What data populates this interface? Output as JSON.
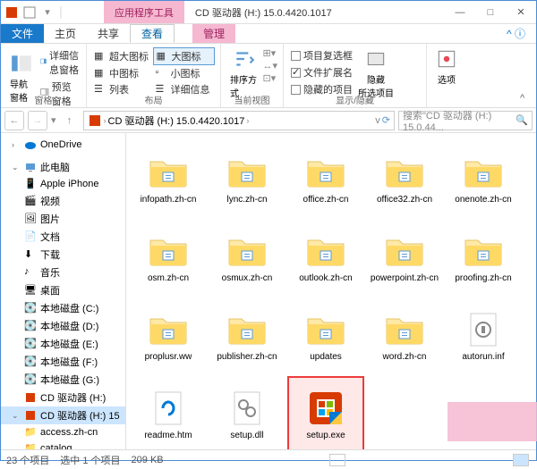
{
  "titlebar": {
    "tool_tab": "应用程序工具",
    "title": "CD 驱动器 (H:) 15.0.4420.1017"
  },
  "win_controls": {
    "min": "—",
    "max": "□",
    "close": "✕"
  },
  "tabs": {
    "file": "文件",
    "home": "主页",
    "share": "共享",
    "view": "查看",
    "manage": "管理"
  },
  "ribbon": {
    "panes": {
      "nav": "导航窗格",
      "detail_pane": "详细信息窗格",
      "preview_pane": "预览窗格",
      "group_label": "窗格"
    },
    "layout": {
      "extra_large": "超大图标",
      "large": "大图标",
      "medium": "中图标",
      "small": "小图标",
      "list": "列表",
      "details": "详细信息",
      "group_label": "布局"
    },
    "view": {
      "sort": "排序方式",
      "group_label": "当前视图"
    },
    "showhide": {
      "item_checkboxes": "项目复选框",
      "file_ext": "文件扩展名",
      "hidden_items": "隐藏的项目",
      "hide_selected_big": "隐藏",
      "hide_selected_sub": "所选项目",
      "group_label": "显示/隐藏"
    },
    "options": "选项"
  },
  "addr": {
    "root": "",
    "seg1": "CD 驱动器 (H:) 15.0.4420.1017",
    "search_placeholder": "搜索\"CD 驱动器 (H:) 15.0.44..."
  },
  "sidebar": {
    "onedrive": "OneDrive",
    "thispc": "此电脑",
    "iphone": "Apple iPhone",
    "videos": "视频",
    "pictures": "图片",
    "documents": "文档",
    "downloads": "下载",
    "music": "音乐",
    "desktop": "桌面",
    "disk_c": "本地磁盘 (C:)",
    "disk_d": "本地磁盘 (D:)",
    "disk_e": "本地磁盘 (E:)",
    "disk_f": "本地磁盘 (F:)",
    "disk_g": "本地磁盘 (G:)",
    "cd_h": "CD 驱动器 (H:)",
    "cd_h_sel": "CD 驱动器 (H:) 15",
    "access": "access.zh-cn",
    "catalog": "catalog"
  },
  "items": [
    {
      "name": "infopath.zh-cn",
      "type": "folder"
    },
    {
      "name": "lync.zh-cn",
      "type": "folder"
    },
    {
      "name": "office.zh-cn",
      "type": "folder"
    },
    {
      "name": "office32.zh-cn",
      "type": "folder"
    },
    {
      "name": "onenote.zh-cn",
      "type": "folder"
    },
    {
      "name": "osm.zh-cn",
      "type": "folder"
    },
    {
      "name": "osmux.zh-cn",
      "type": "folder"
    },
    {
      "name": "outlook.zh-cn",
      "type": "folder"
    },
    {
      "name": "powerpoint.zh-cn",
      "type": "folder"
    },
    {
      "name": "proofing.zh-cn",
      "type": "folder"
    },
    {
      "name": "proplusr.ww",
      "type": "folder"
    },
    {
      "name": "publisher.zh-cn",
      "type": "folder"
    },
    {
      "name": "updates",
      "type": "folder"
    },
    {
      "name": "word.zh-cn",
      "type": "folder"
    },
    {
      "name": "autorun.inf",
      "type": "inf"
    },
    {
      "name": "readme.htm",
      "type": "htm"
    },
    {
      "name": "setup.dll",
      "type": "dll"
    },
    {
      "name": "setup.exe",
      "type": "exe",
      "selected": true
    }
  ],
  "status": {
    "count": "23 个项目",
    "selected": "选中 1 个项目",
    "size": "209 KB"
  }
}
